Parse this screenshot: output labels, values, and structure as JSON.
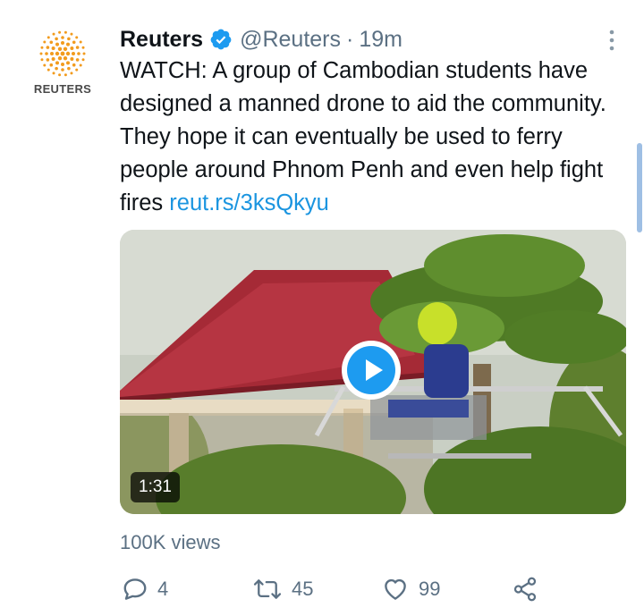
{
  "tweet": {
    "avatar_label": "REUTERS",
    "author_name": "Reuters",
    "handle": "@Reuters",
    "separator": "·",
    "time": "19m",
    "text": "WATCH: A group of Cambodian students have designed a manned drone to aid the community. They hope it can eventually be used to ferry people around Phnom Penh and even help fight fires",
    "link": "reut.rs/3ksQkyu",
    "video_duration": "1:31",
    "views": "100K views",
    "replies": "4",
    "retweets": "45",
    "likes": "99"
  },
  "colors": {
    "accent": "#1b95e0",
    "muted": "#5b7083",
    "brand_orange": "#f29b1d"
  },
  "icons": {
    "verified": "verified-badge-icon",
    "menu": "more-vertical-icon",
    "play": "play-icon",
    "reply": "reply-icon",
    "retweet": "retweet-icon",
    "like": "heart-icon",
    "share": "share-icon"
  }
}
